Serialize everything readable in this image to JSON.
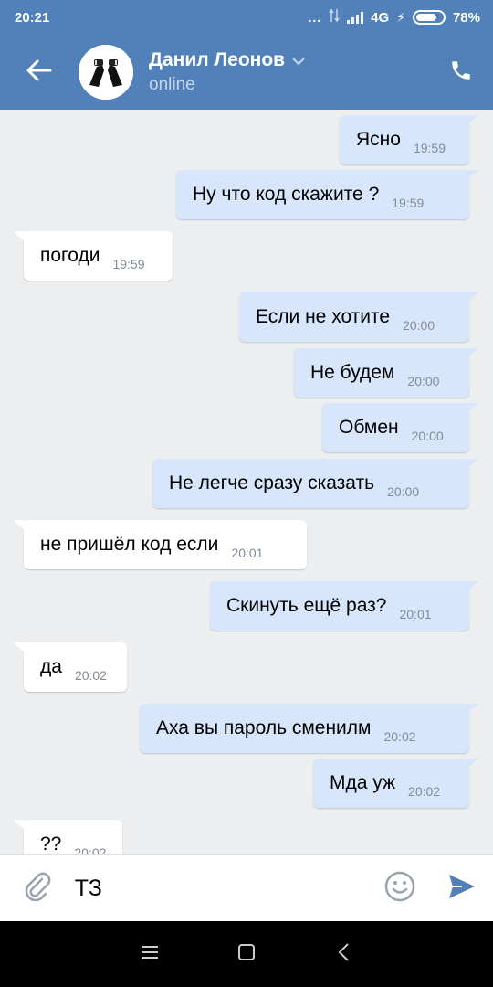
{
  "status_bar": {
    "time": "20:21",
    "dots": "...",
    "network": "4G",
    "battery": "78%",
    "battery_level": 0.78
  },
  "header": {
    "contact_name": "Данил Леонов",
    "contact_status": "online"
  },
  "messages": [
    {
      "dir": "out",
      "text": "Ясно",
      "time": "19:59"
    },
    {
      "dir": "out",
      "text": "Ну что код скажите ?",
      "time": "19:59"
    },
    {
      "dir": "in",
      "text": "погоди",
      "time": "19:59"
    },
    {
      "dir": "out",
      "text": "Если не хотите",
      "time": "20:00"
    },
    {
      "dir": "out",
      "text": "Не будем",
      "time": "20:00"
    },
    {
      "dir": "out",
      "text": "Обмен",
      "time": "20:00"
    },
    {
      "dir": "out",
      "text": "Не легче сразу сказать",
      "time": "20:00"
    },
    {
      "dir": "in",
      "text": "не пришёл код если",
      "time": "20:01"
    },
    {
      "dir": "out",
      "text": "Скинуть ещё раз?",
      "time": "20:01"
    },
    {
      "dir": "in",
      "text": "да",
      "time": "20:02"
    },
    {
      "dir": "out",
      "text": "Аха вы пароль сменилм",
      "time": "20:02"
    },
    {
      "dir": "out",
      "text": "Мда уж",
      "time": "20:02"
    },
    {
      "dir": "in",
      "text": "??",
      "time": "20:02"
    }
  ],
  "composer": {
    "input_value": "ТЗ"
  },
  "colors": {
    "accent": "#5181b8",
    "bubble_out": "#d7e6fb",
    "bubble_in": "#ffffff",
    "background": "#edeef0"
  },
  "icons": {
    "back": "arrow-left-icon",
    "call": "phone-icon",
    "attach": "paperclip-icon",
    "emoji": "smiley-icon",
    "send": "send-icon",
    "nav_menu": "menu-icon",
    "nav_home": "square-icon",
    "nav_back": "chevron-left-icon"
  }
}
